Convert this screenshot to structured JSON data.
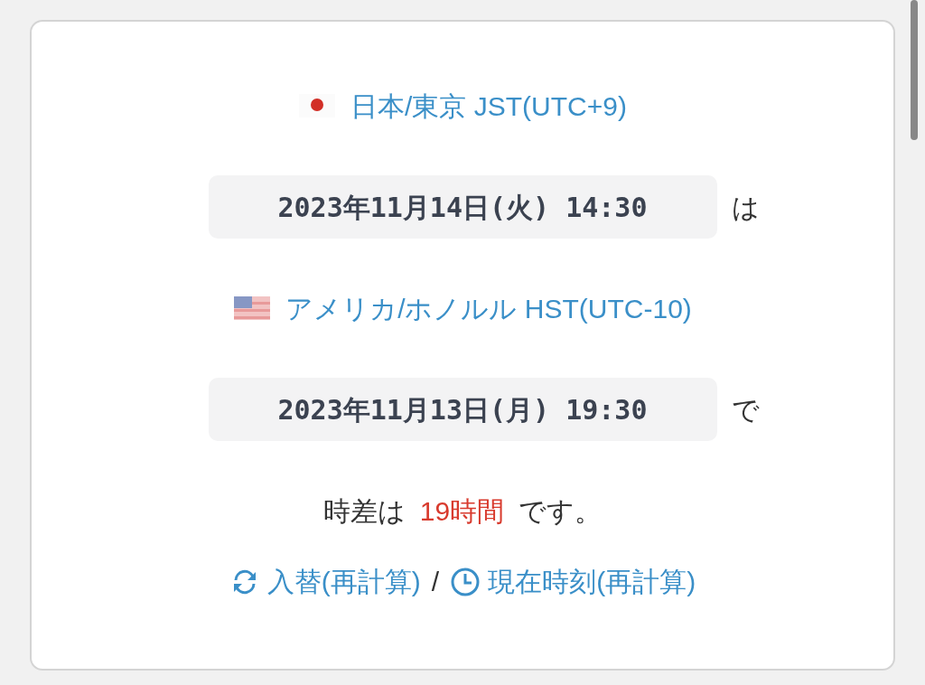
{
  "from_zone": {
    "kind": "japan",
    "label": "日本/東京 JST(UTC+9)"
  },
  "from_time": {
    "value": "2023年11月14日(火) 14:30",
    "suffix": "は"
  },
  "to_zone": {
    "kind": "usa",
    "label": "アメリカ/ホノルル HST(UTC-10)"
  },
  "to_time": {
    "value": "2023年11月13日(月) 19:30",
    "suffix": "で"
  },
  "difference": {
    "prefix": "時差は",
    "value": "19時間",
    "suffix": "です。"
  },
  "actions": [
    {
      "kind": "swap",
      "label": "入替(再計算)"
    },
    {
      "kind": "now",
      "label": "現在時刻(再計算)"
    }
  ],
  "separator": "/"
}
